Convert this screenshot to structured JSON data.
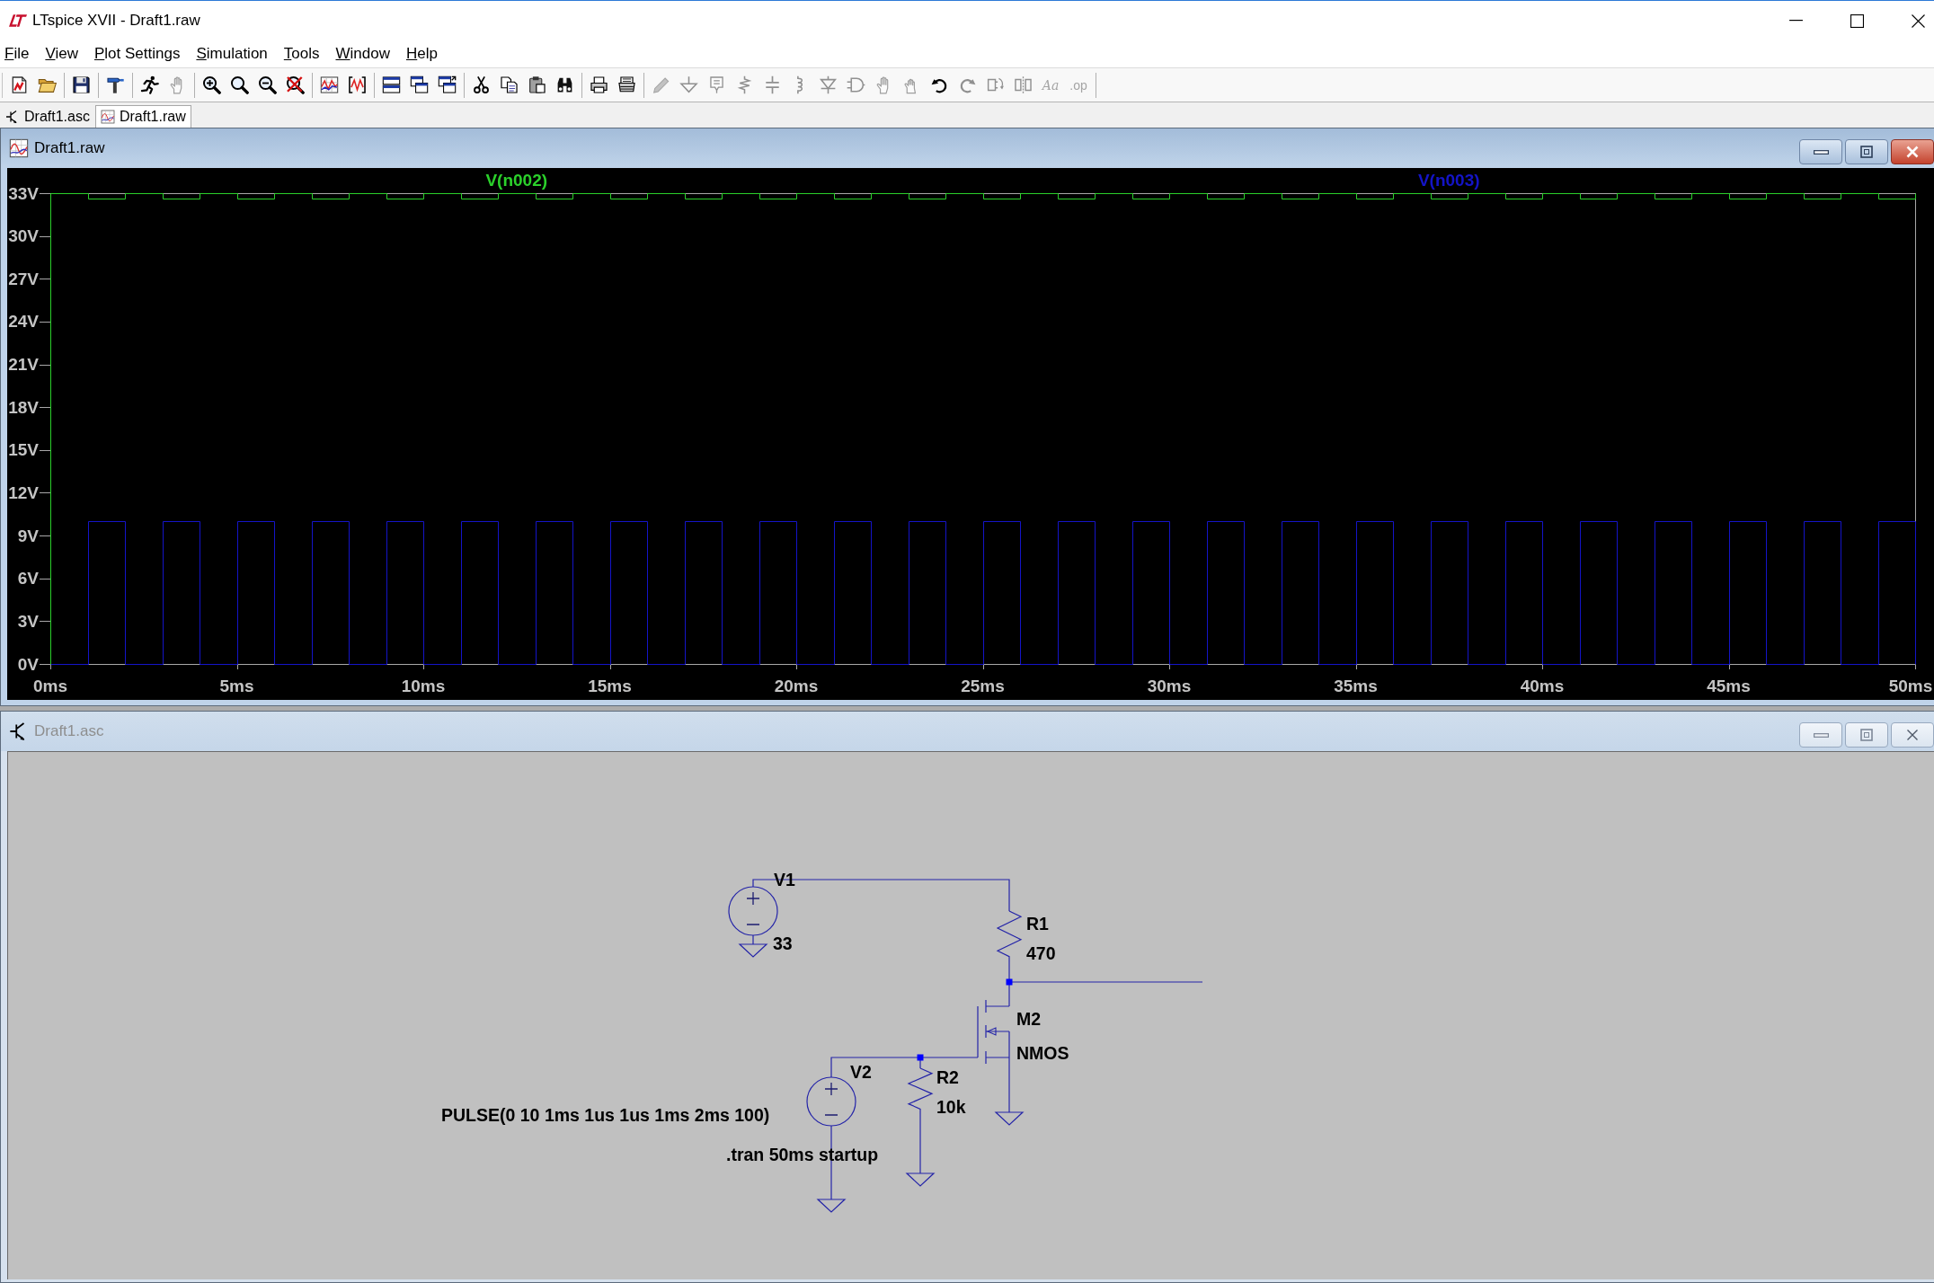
{
  "window": {
    "title": "LTspice XVII - Draft1.raw"
  },
  "menu": [
    "File",
    "View",
    "Plot Settings",
    "Simulation",
    "Tools",
    "Window",
    "Help"
  ],
  "toolbar": [
    {
      "buttons": [
        {
          "disabled": false
        },
        {
          "disabled": false
        }
      ]
    },
    {
      "buttons": [
        {
          "disabled": false
        }
      ]
    },
    {
      "buttons": [
        {
          "disabled": false
        }
      ]
    },
    {
      "buttons": [
        {
          "disabled": false
        },
        {
          "disabled": true
        }
      ]
    },
    {
      "buttons": [
        {
          "disabled": false
        },
        {
          "disabled": false
        },
        {
          "disabled": false
        },
        {
          "disabled": false
        }
      ]
    },
    {
      "buttons": [
        {
          "disabled": false
        },
        {
          "disabled": false
        }
      ]
    },
    {
      "buttons": [
        {
          "disabled": false
        },
        {
          "disabled": false
        },
        {
          "disabled": false
        }
      ]
    },
    {
      "buttons": [
        {
          "disabled": false
        },
        {
          "disabled": false
        },
        {
          "disabled": false
        },
        {
          "disabled": false
        }
      ]
    },
    {
      "buttons": [
        {
          "disabled": false
        },
        {
          "disabled": false
        }
      ]
    },
    {
      "buttons": [
        {
          "disabled": true
        },
        {
          "disabled": true
        },
        {
          "disabled": true
        },
        {
          "disabled": true
        },
        {
          "disabled": true
        },
        {
          "disabled": true
        },
        {
          "disabled": true
        },
        {
          "disabled": true
        },
        {
          "disabled": true
        },
        {
          "disabled": true
        },
        {
          "disabled": false
        },
        {
          "disabled": true
        },
        {
          "disabled": true
        },
        {
          "disabled": true
        },
        {
          "label": "Aa",
          "disabled": true
        },
        {
          "label": ".op",
          "disabled": true
        }
      ]
    }
  ],
  "tabs": [
    {
      "label": "Draft1.asc",
      "kind": "schematic",
      "selected": false
    },
    {
      "label": "Draft1.raw",
      "kind": "plot",
      "selected": true
    }
  ],
  "plot_window": {
    "title": "Draft1.raw",
    "active": true,
    "chart_data": {
      "type": "line",
      "xlim": [
        0,
        50
      ],
      "ylim": [
        0,
        33
      ],
      "xticks": [
        {
          "value": 0,
          "label": "0ms"
        },
        {
          "value": 5,
          "label": "5ms"
        },
        {
          "value": 10,
          "label": "10ms"
        },
        {
          "value": 15,
          "label": "15ms"
        },
        {
          "value": 20,
          "label": "20ms"
        },
        {
          "value": 25,
          "label": "25ms"
        },
        {
          "value": 30,
          "label": "30ms"
        },
        {
          "value": 35,
          "label": "35ms"
        },
        {
          "value": 40,
          "label": "40ms"
        },
        {
          "value": 45,
          "label": "45ms"
        },
        {
          "value": 50,
          "label": "50ms"
        }
      ],
      "yticks": [
        {
          "value": 0,
          "label": "0V"
        },
        {
          "value": 3,
          "label": "3V"
        },
        {
          "value": 6,
          "label": "6V"
        },
        {
          "value": 9,
          "label": "9V"
        },
        {
          "value": 12,
          "label": "12V"
        },
        {
          "value": 15,
          "label": "15V"
        },
        {
          "value": 18,
          "label": "18V"
        },
        {
          "value": 21,
          "label": "21V"
        },
        {
          "value": 24,
          "label": "24V"
        },
        {
          "value": 27,
          "label": "27V"
        },
        {
          "value": 30,
          "label": "30V"
        },
        {
          "value": 33,
          "label": "33V"
        }
      ],
      "x": [
        0,
        0,
        1,
        1,
        2,
        2,
        3,
        3,
        4,
        4,
        5,
        5,
        6,
        6,
        7,
        7,
        8,
        8,
        9,
        9,
        10,
        10,
        11,
        11,
        12,
        12,
        13,
        13,
        14,
        14,
        15,
        15,
        16,
        16,
        17,
        17,
        18,
        18,
        19,
        19,
        20,
        20,
        21,
        21,
        22,
        22,
        23,
        23,
        24,
        24,
        25,
        25,
        26,
        26,
        27,
        27,
        28,
        28,
        29,
        29,
        30,
        30,
        31,
        31,
        32,
        32,
        33,
        33,
        34,
        34,
        35,
        35,
        36,
        36,
        37,
        37,
        38,
        38,
        39,
        39,
        40,
        40,
        41,
        41,
        42,
        42,
        43,
        43,
        44,
        44,
        45,
        45,
        46,
        46,
        47,
        47,
        48,
        48,
        49,
        49,
        50,
        50
      ],
      "series": [
        {
          "name": "V(n002)",
          "color": "#2bd02b",
          "values": [
            0,
            33,
            33,
            32.6,
            32.6,
            33,
            33,
            32.6,
            32.6,
            33,
            33,
            32.6,
            32.6,
            33,
            33,
            32.6,
            32.6,
            33,
            33,
            32.6,
            32.6,
            33,
            33,
            32.6,
            32.6,
            33,
            33,
            32.6,
            32.6,
            33,
            33,
            32.6,
            32.6,
            33,
            33,
            32.6,
            32.6,
            33,
            33,
            32.6,
            32.6,
            33,
            33,
            32.6,
            32.6,
            33,
            33,
            32.6,
            32.6,
            33,
            33,
            32.6,
            32.6,
            33,
            33,
            32.6,
            32.6,
            33,
            33,
            32.6,
            32.6,
            33,
            33,
            32.6,
            32.6,
            33,
            33,
            32.6,
            32.6,
            33,
            33,
            32.6,
            32.6,
            33,
            33,
            32.6,
            32.6,
            33,
            33,
            32.6,
            32.6,
            33,
            33,
            32.6,
            32.6,
            33,
            33,
            32.6,
            32.6,
            33,
            33,
            32.6,
            32.6,
            33,
            33,
            32.6,
            32.6,
            33,
            33,
            32.6,
            32.6,
            33
          ]
        },
        {
          "name": "V(n003)",
          "color": "#1414c8",
          "values": [
            0,
            0,
            0,
            10,
            10,
            0,
            0,
            10,
            10,
            0,
            0,
            10,
            10,
            0,
            0,
            10,
            10,
            0,
            0,
            10,
            10,
            0,
            0,
            10,
            10,
            0,
            0,
            10,
            10,
            0,
            0,
            10,
            10,
            0,
            0,
            10,
            10,
            0,
            0,
            10,
            10,
            0,
            0,
            10,
            10,
            0,
            0,
            10,
            10,
            0,
            0,
            10,
            10,
            0,
            0,
            10,
            10,
            0,
            0,
            10,
            10,
            0,
            0,
            10,
            10,
            0,
            0,
            10,
            10,
            0,
            0,
            10,
            10,
            0,
            0,
            10,
            10,
            0,
            0,
            10,
            10,
            0,
            0,
            10,
            10,
            0,
            0,
            10,
            10,
            0,
            0,
            10,
            10,
            0,
            0,
            10,
            10,
            0,
            0,
            10,
            10,
            0
          ]
        }
      ]
    }
  },
  "schematic_window": {
    "title": "Draft1.asc",
    "active": false,
    "components": [
      {
        "kind": "voltage_source",
        "name": "V1",
        "value": "33"
      },
      {
        "kind": "resistor",
        "name": "R1",
        "value": "470"
      },
      {
        "kind": "nmos",
        "name": "M2",
        "value": "NMOS"
      },
      {
        "kind": "voltage_source",
        "name": "V2",
        "value": "PULSE(0 10 1ms 1us 1us 1ms 2ms 100)"
      },
      {
        "kind": "resistor",
        "name": "R2",
        "value": "10k"
      }
    ],
    "directive": ".tran 50ms startup"
  }
}
